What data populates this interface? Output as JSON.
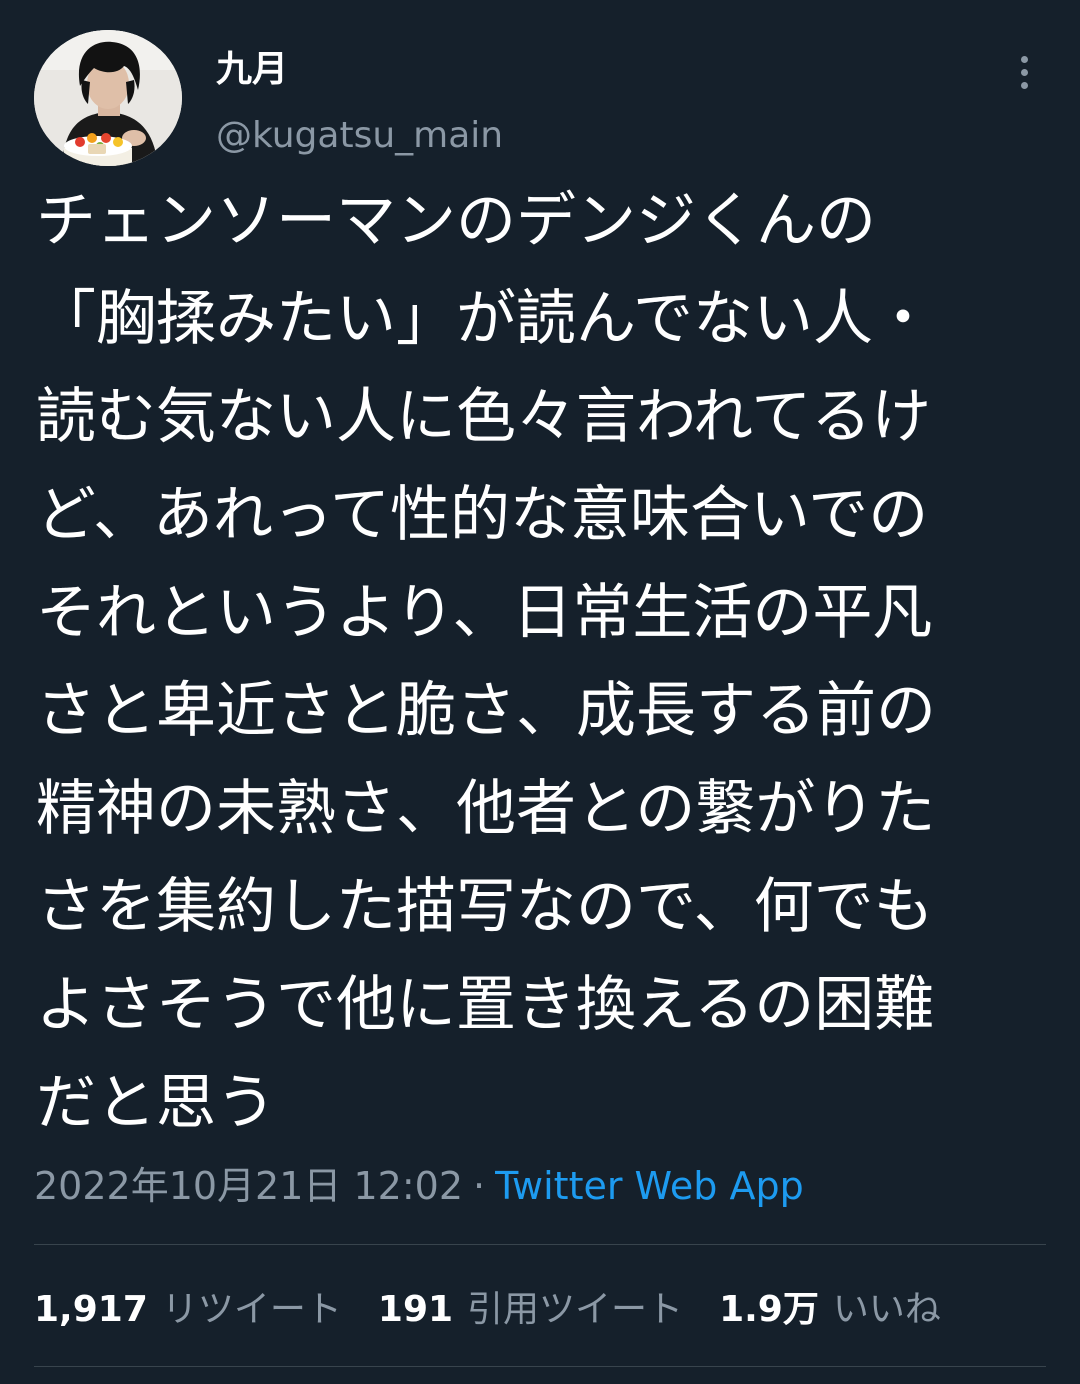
{
  "author": {
    "display_name": "九月",
    "handle": "@kugatsu_main"
  },
  "tweet": {
    "lines": [
      "チェンソーマンのデンジくんの",
      "「胸揉みたい」が読んでない人・",
      "読む気ない人に色々言われてるけ",
      "ど、あれって性的な意味合いでの",
      "それというより、日常生活の平凡",
      "さと卑近さと脆さ、成長する前の",
      "精神の未熟さ、他者との繋がりた",
      "さを集約した描写なので、何でも",
      "よさそうで他に置き換えるの困難",
      "だと思う"
    ]
  },
  "meta": {
    "timestamp": "2022年10月21日 12:02",
    "separator": "·",
    "source": "Twitter Web App"
  },
  "stats": {
    "retweets": {
      "count": "1,917",
      "label": "リツイート"
    },
    "quotes": {
      "count": "191",
      "label": "引用ツイート"
    },
    "likes": {
      "count": "1.9万",
      "label": "いいね"
    }
  },
  "colors": {
    "background": "#15202b",
    "text": "#ffffff",
    "secondary": "#8b98a5",
    "accent": "#1d9bf0",
    "divider": "#38444d"
  },
  "icons": {
    "more": "more-vertical-icon"
  }
}
